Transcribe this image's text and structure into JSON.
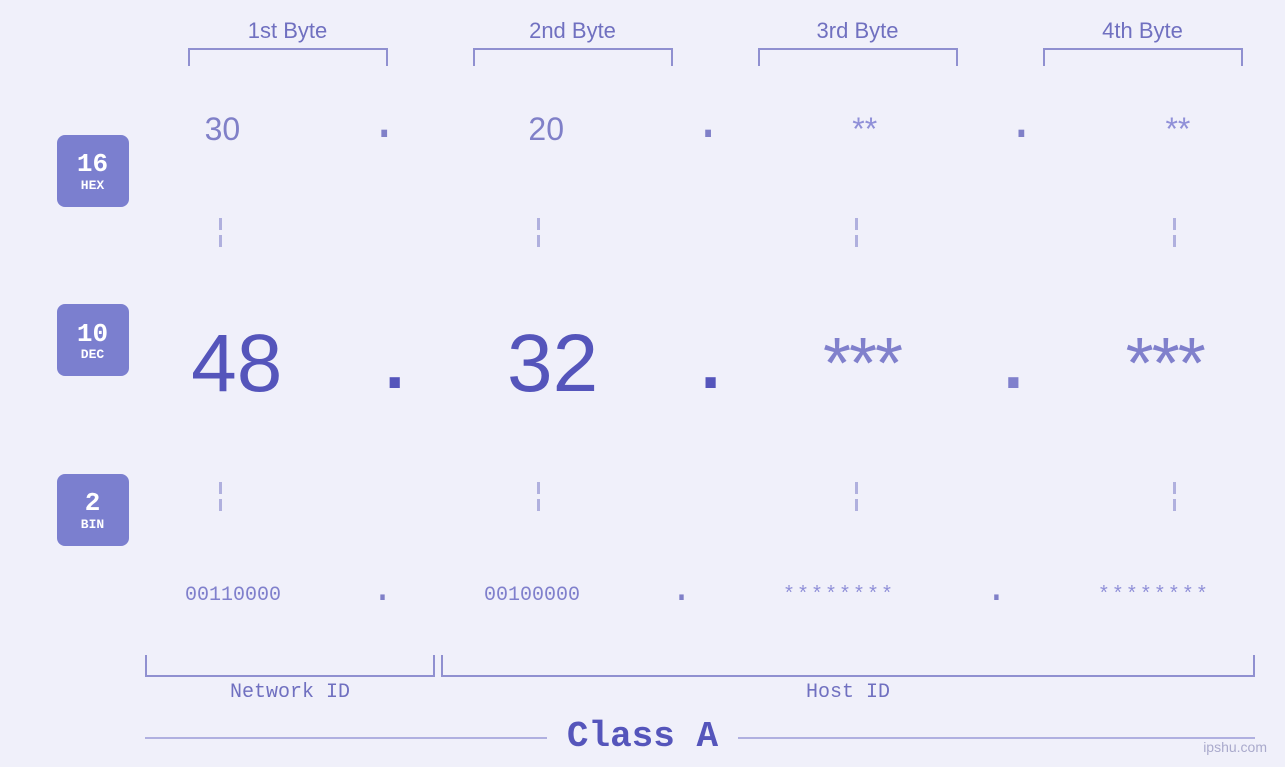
{
  "headers": {
    "byte1": "1st Byte",
    "byte2": "2nd Byte",
    "byte3": "3rd Byte",
    "byte4": "4th Byte"
  },
  "badges": {
    "hex": {
      "num": "16",
      "label": "HEX"
    },
    "dec": {
      "num": "10",
      "label": "DEC"
    },
    "bin": {
      "num": "2",
      "label": "BIN"
    }
  },
  "hex_row": {
    "b1": "30",
    "b2": "20",
    "b3": "**",
    "b4": "**"
  },
  "dec_row": {
    "b1": "48",
    "b2": "32",
    "b3": "***",
    "b4": "***"
  },
  "bin_row": {
    "b1": "00110000",
    "b2": "00100000",
    "b3": "********",
    "b4": "********"
  },
  "labels": {
    "network_id": "Network ID",
    "host_id": "Host ID",
    "class": "Class A"
  },
  "watermark": "ipshu.com"
}
